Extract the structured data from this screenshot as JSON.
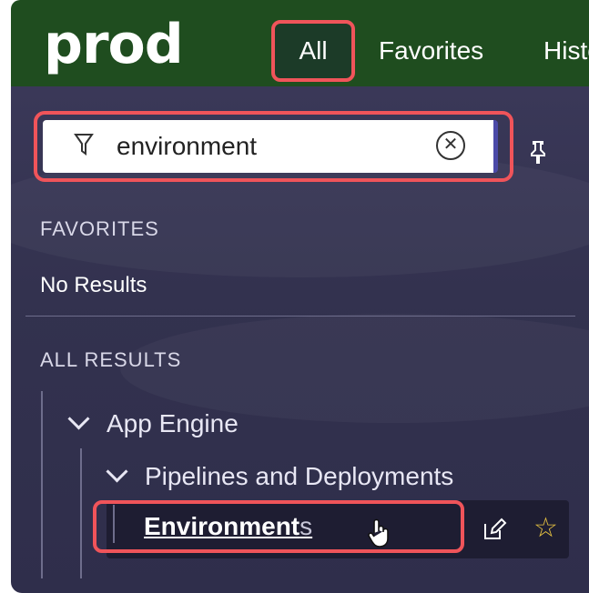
{
  "header": {
    "logo": "prod",
    "tabs": [
      {
        "label": "All",
        "selected": true
      },
      {
        "label": "Favorites"
      },
      {
        "label": "Histo"
      }
    ],
    "bg_color": "#1f4d1f"
  },
  "search": {
    "value": "environment",
    "filter_icon": "filter-icon",
    "clear_icon": "clear-icon"
  },
  "pin_icon": "pin-icon",
  "favorites": {
    "title": "FAVORITES",
    "empty": "No Results"
  },
  "all_results": {
    "title": "ALL RESULTS",
    "tree": {
      "app": "App Engine",
      "group": "Pipelines and Deployments",
      "leaf_main": "Environment",
      "leaf_tail": "s"
    }
  },
  "highlight_color": "#f0545a"
}
